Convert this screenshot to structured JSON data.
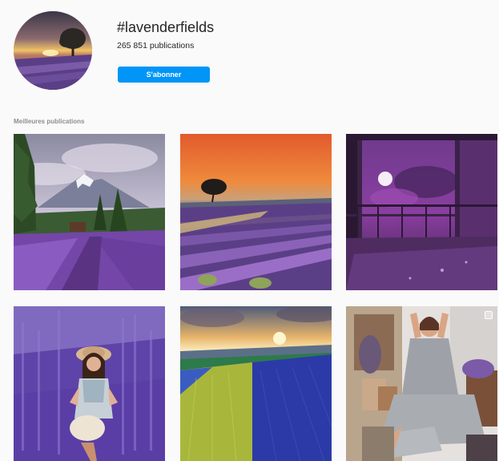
{
  "header": {
    "hashtag": "#lavenderfields",
    "post_count": "265 851 publications",
    "follow_label": "S'abonner"
  },
  "sections": {
    "top_posts_label": "Meilleures publications"
  },
  "posts": [
    {
      "subject": "mountain-lavender-field"
    },
    {
      "subject": "sunset-tree-lavender-rows"
    },
    {
      "subject": "moon-night-lavender-porch"
    },
    {
      "subject": "woman-hat-lavender-field"
    },
    {
      "subject": "sunrise-colored-fields"
    },
    {
      "subject": "woman-gray-dress-lavender"
    }
  ],
  "colors": {
    "accent": "#0095f6",
    "background": "#fafafa",
    "text": "#262626",
    "muted": "#8e8e8e"
  }
}
